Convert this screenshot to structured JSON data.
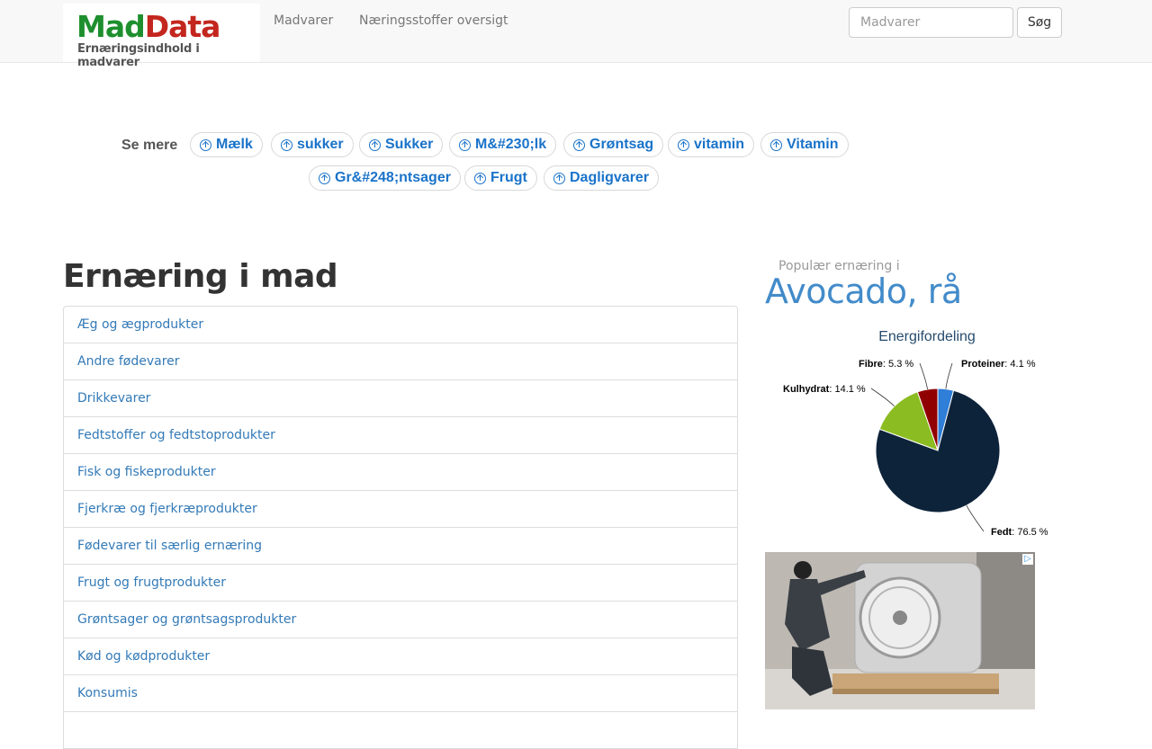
{
  "brand": {
    "name_part1": "Mad",
    "name_part2": "Data",
    "tagline": "Ernæringsindhold i madvarer"
  },
  "nav": {
    "items": [
      "Madvarer",
      "Næringsstoffer oversigt"
    ],
    "search_placeholder": "Madvarer",
    "search_button": "Søg"
  },
  "see_more": {
    "label": "Se mere",
    "tags": [
      "Mælk",
      "sukker",
      "Sukker",
      "M&#230;lk",
      "Grøntsag",
      "vitamin",
      "Vitamin",
      "Gr&#248;ntsager",
      "Frugt",
      "Dagligvarer"
    ]
  },
  "main": {
    "title": "Ernæring i mad",
    "categories": [
      "Æg og ægprodukter",
      "Andre fødevarer",
      "Drikkevarer",
      "Fedtstoffer og fedtstoprodukter",
      "Fisk og fiskeprodukter",
      "Fjerkræ og fjerkræprodukter",
      "Fødevarer til særlig ernæring",
      "Frugt og frugtprodukter",
      "Grøntsager og grøntsagsprodukter",
      "Kød og kødprodukter",
      "Konsumis",
      ""
    ]
  },
  "sidebar": {
    "popular_label": "Populær ernæring i",
    "food_name": "Avocado, rå"
  },
  "chart_data": {
    "type": "pie",
    "title": "Energifordeling",
    "slices": [
      {
        "name": "Proteiner",
        "value": 4.1,
        "label": "4.1 %",
        "color": "#2f7ed8"
      },
      {
        "name": "Fedt",
        "value": 76.5,
        "label": "76.5 %",
        "color": "#0d233a"
      },
      {
        "name": "Kulhydrat",
        "value": 14.1,
        "label": "14.1 %",
        "color": "#8bbc21"
      },
      {
        "name": "Fibre",
        "value": 5.3,
        "label": "5.3 %",
        "color": "#910000"
      }
    ]
  },
  "ad": {
    "badge_icon": "adchoices-icon"
  }
}
